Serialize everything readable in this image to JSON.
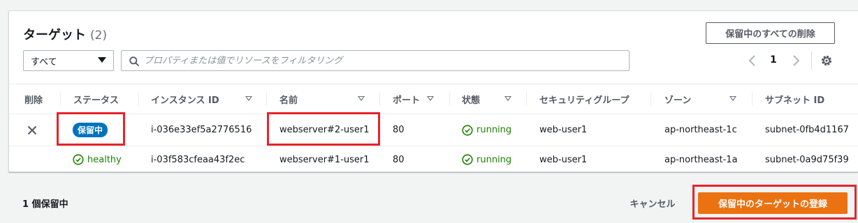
{
  "panel": {
    "title": "ターゲット",
    "count": "(2)",
    "remove_all_label": "保留中のすべての削除",
    "filter_select": {
      "selected": "すべて"
    },
    "search": {
      "placeholder": "プロパティまたは値でリソースをフィルタリング"
    },
    "pagination": {
      "current_page": "1"
    }
  },
  "table": {
    "columns": [
      {
        "key": "remove",
        "label": "削除"
      },
      {
        "key": "status",
        "label": "ステータス"
      },
      {
        "key": "instance_id",
        "label": "インスタンス ID"
      },
      {
        "key": "name",
        "label": "名前"
      },
      {
        "key": "port",
        "label": "ポート"
      },
      {
        "key": "state",
        "label": "状態"
      },
      {
        "key": "security_group",
        "label": "セキュリティグループ"
      },
      {
        "key": "zone",
        "label": "ゾーン"
      },
      {
        "key": "subnet_id",
        "label": "サブネット ID"
      }
    ],
    "rows": [
      {
        "remove": "×",
        "status": "保留中",
        "instance_id": "i-036e33ef5a2776516",
        "name": "webserver#2-user1",
        "port": "80",
        "state": "running",
        "security_group": "web-user1",
        "zone": "ap-northeast-1c",
        "subnet_id": "subnet-0fb4d1167"
      },
      {
        "remove": "",
        "status": "healthy",
        "instance_id": "i-03f583cfeaa43f2ec",
        "name": "webserver#1-user1",
        "port": "80",
        "state": "running",
        "security_group": "web-user1",
        "zone": "ap-northeast-1a",
        "subnet_id": "subnet-0a9d75f39"
      }
    ]
  },
  "footer": {
    "pending_count": "1 個保留中",
    "cancel_label": "キャンセル",
    "register_label": "保留中のターゲットの登録"
  },
  "colors": {
    "accent_orange": "#ec7211",
    "badge_blue": "#0073bb",
    "healthy_green": "#1d8102",
    "highlight_red": "#e8232a"
  },
  "icons": {
    "search": "search-icon",
    "prev": "chevron-left-icon",
    "next": "chevron-right-icon",
    "settings": "gear-icon",
    "remove": "close-icon",
    "status_ok": "check-circle-icon"
  }
}
